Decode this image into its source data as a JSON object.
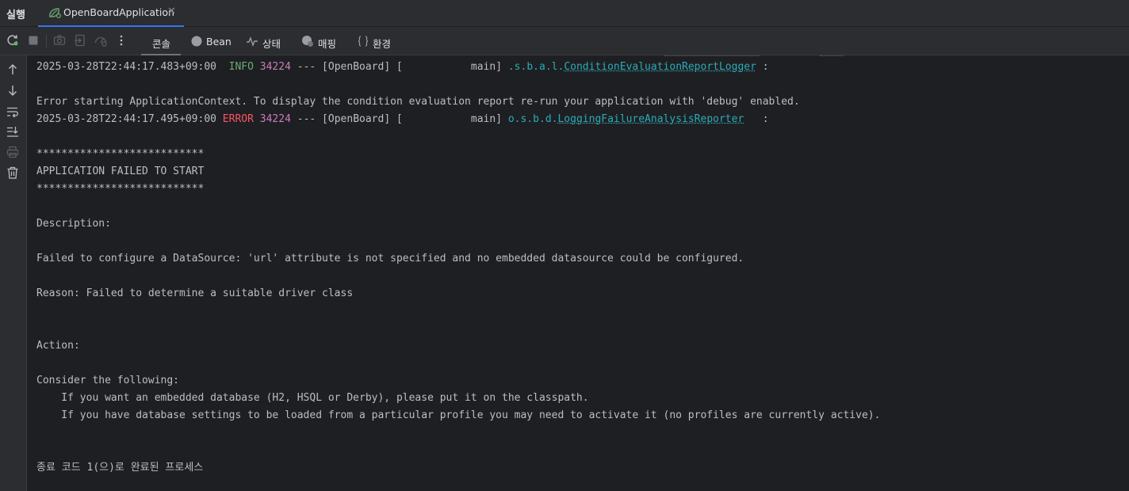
{
  "topbar": {
    "run_label": "실행",
    "tab_label": "OpenBoardApplication",
    "tab_close": "✕"
  },
  "toolbar": {
    "tabs": [
      {
        "label": "콘솔",
        "icon": "console-icon",
        "active": true
      },
      {
        "label": "Bean",
        "icon": "bean-icon"
      },
      {
        "label": "상태",
        "icon": "health-icon"
      },
      {
        "label": "매핑",
        "icon": "mappings-icon"
      },
      {
        "label": "환경",
        "icon": "environment-icon"
      }
    ]
  },
  "console": {
    "lines": [
      {
        "ts": "2025-03-28T22:44:17.483+09:00",
        "level": " INFO",
        "pid": "34224",
        "mid": " --- [OpenBoard] [           main] ",
        "pkg": ".s.b.a.l.",
        "logger": "ConditionEvaluationReportLogger",
        "tail": " :"
      },
      {
        "text": ""
      },
      {
        "text": "Error starting ApplicationContext. To display the condition evaluation report re-run your application with 'debug' enabled."
      },
      {
        "ts": "2025-03-28T22:44:17.495+09:00",
        "level": "ERROR",
        "pid": "34224",
        "mid": " --- [OpenBoard] [           main] ",
        "pkg": "o.s.b.d.",
        "logger": "LoggingFailureAnalysisReporter",
        "tail": "   :"
      },
      {
        "text": ""
      },
      {
        "text": "***************************"
      },
      {
        "text": "APPLICATION FAILED TO START"
      },
      {
        "text": "***************************"
      },
      {
        "text": ""
      },
      {
        "text": "Description:"
      },
      {
        "text": ""
      },
      {
        "text": "Failed to configure a DataSource: 'url' attribute is not specified and no embedded datasource could be configured."
      },
      {
        "text": ""
      },
      {
        "text": "Reason: Failed to determine a suitable driver class"
      },
      {
        "text": ""
      },
      {
        "text": ""
      },
      {
        "text": "Action:"
      },
      {
        "text": ""
      },
      {
        "text": "Consider the following:"
      },
      {
        "text": "    If you want an embedded database (H2, HSQL or Derby), please put it on the classpath."
      },
      {
        "text": "    If you have database settings to be loaded from a particular profile you may need to activate it (no profiles are currently active)."
      },
      {
        "text": ""
      },
      {
        "text": ""
      },
      {
        "text": "종료 코드 1(으)로 완료된 프로세스"
      }
    ]
  },
  "colors": {
    "info": "#6aab73",
    "error": "#f75464",
    "pid": "#c77dbb",
    "logger": "#2aacb8",
    "accent": "#3574f0"
  }
}
